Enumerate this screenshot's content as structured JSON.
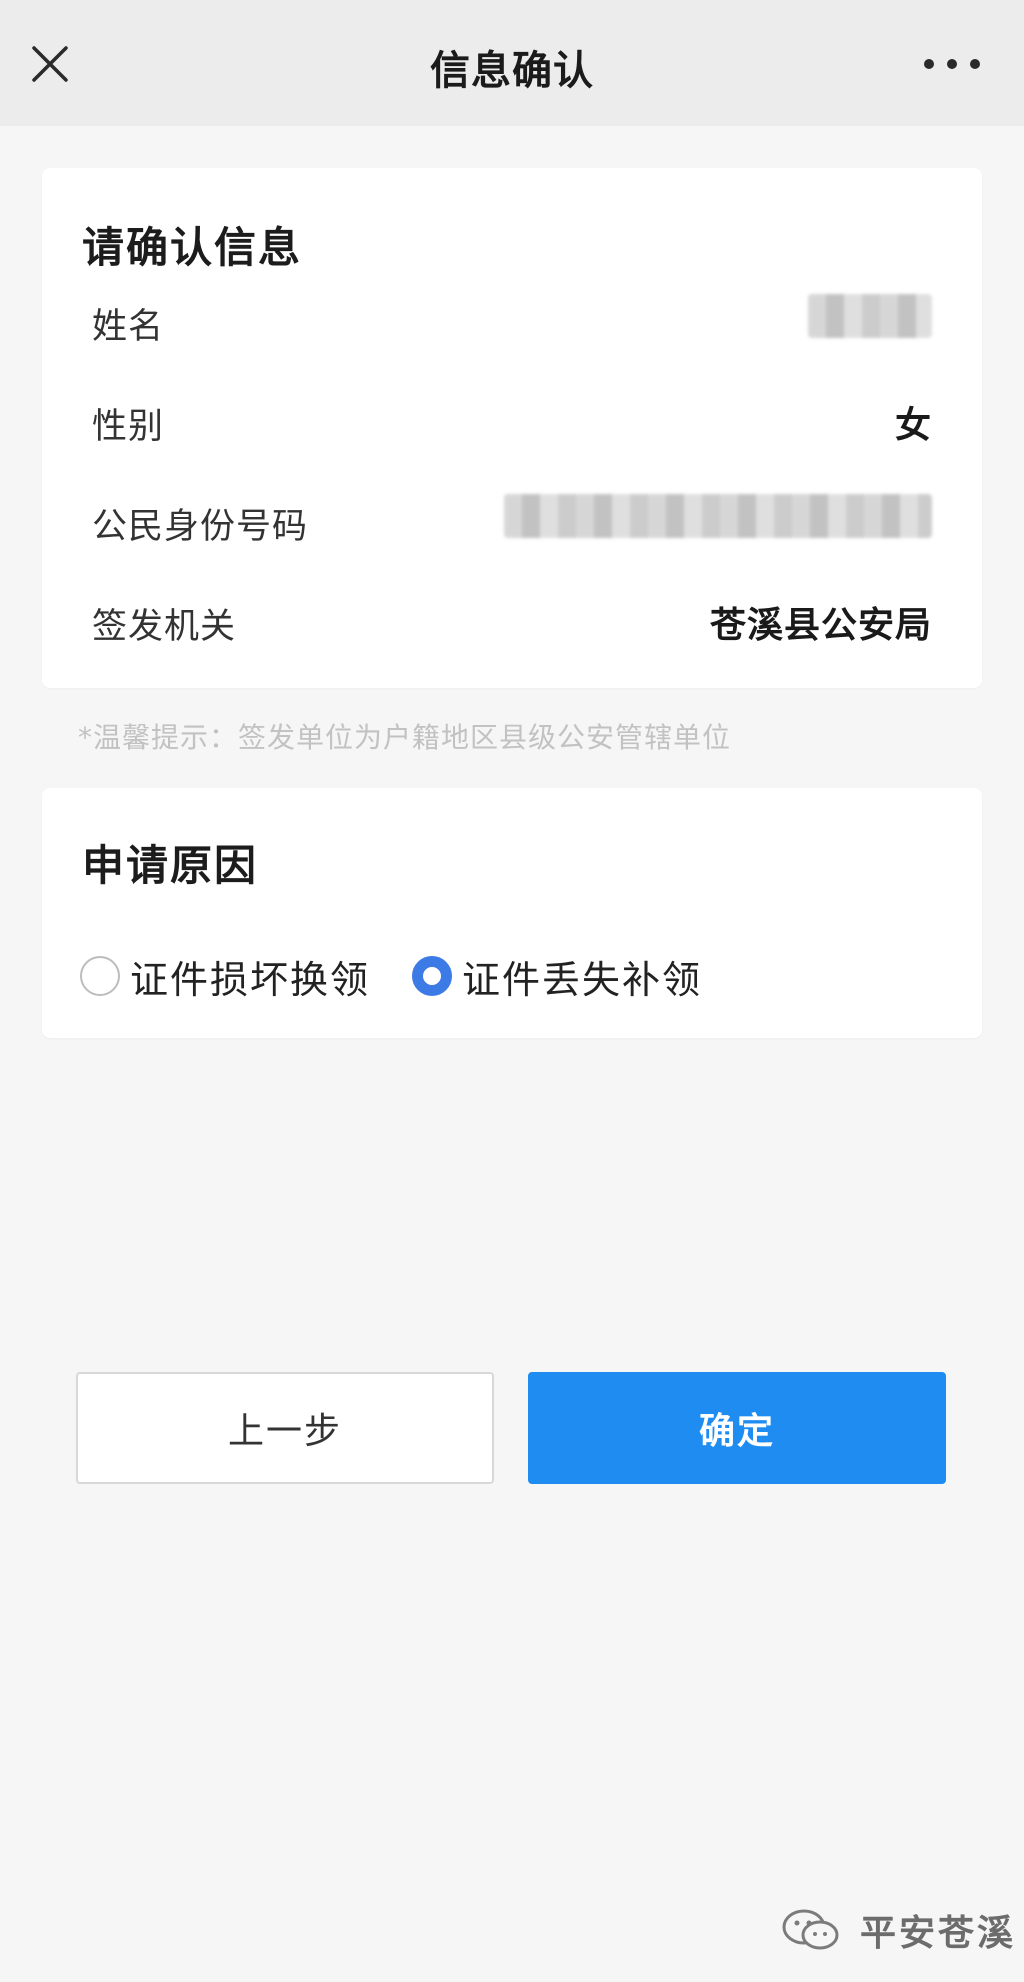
{
  "navbar": {
    "title": "信息确认",
    "close_icon": "close-icon",
    "more_icon": "more-dots-icon"
  },
  "info_card": {
    "title": "请确认信息",
    "rows": [
      {
        "label": "姓名",
        "value": "",
        "masked": true
      },
      {
        "label": "性别",
        "value": "女",
        "masked": false
      },
      {
        "label": "公民身份号码",
        "value": "",
        "masked": true
      },
      {
        "label": "签发机关",
        "value": "苍溪县公安局",
        "masked": false
      }
    ]
  },
  "hint": "*温馨提示：签发单位为户籍地区县级公安管辖单位",
  "reason_card": {
    "title": "申请原因",
    "options": [
      {
        "label": "证件损坏换领",
        "selected": false
      },
      {
        "label": "证件丢失补领",
        "selected": true
      }
    ]
  },
  "buttons": {
    "prev_label": "上一步",
    "confirm_label": "确定"
  },
  "watermark": {
    "text": "平安苍溪",
    "icon": "wechat-icon"
  },
  "colors": {
    "primary": "#1e8cf0",
    "radio_checked": "#3c7be6",
    "background": "#f6f6f6",
    "navbar": "#ececec"
  }
}
